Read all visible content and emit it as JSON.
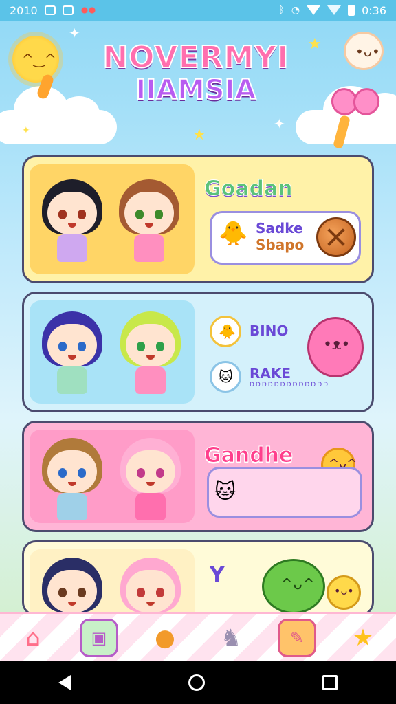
{
  "status_bar": {
    "left_text": "2010",
    "time": "0:36"
  },
  "header": {
    "title_line1": "NOVERMYI",
    "title_line2": "IIAMSIA"
  },
  "cards": [
    {
      "label": "Goadan",
      "bubble_line1": "Sadke",
      "bubble_line2": "Sbapo"
    },
    {
      "row1_label": "BINO",
      "row2_label": "RAKE",
      "row2_sub": "DDDDDDDDDDDDD"
    },
    {
      "label": "Gandhe"
    },
    {
      "label": "Y"
    }
  ],
  "tab_bar": {
    "items": [
      "home-icon",
      "photo-frame-icon",
      "chick-icon",
      "cat-icon",
      "notebook-icon",
      "star-icon"
    ]
  },
  "colors": {
    "status_bar": "#5bc3e8",
    "card_yellow": "#fff2a8",
    "card_blue": "#d4f1fb",
    "card_pink": "#ffb5d6",
    "tab_pink": "#ffe3ef"
  }
}
